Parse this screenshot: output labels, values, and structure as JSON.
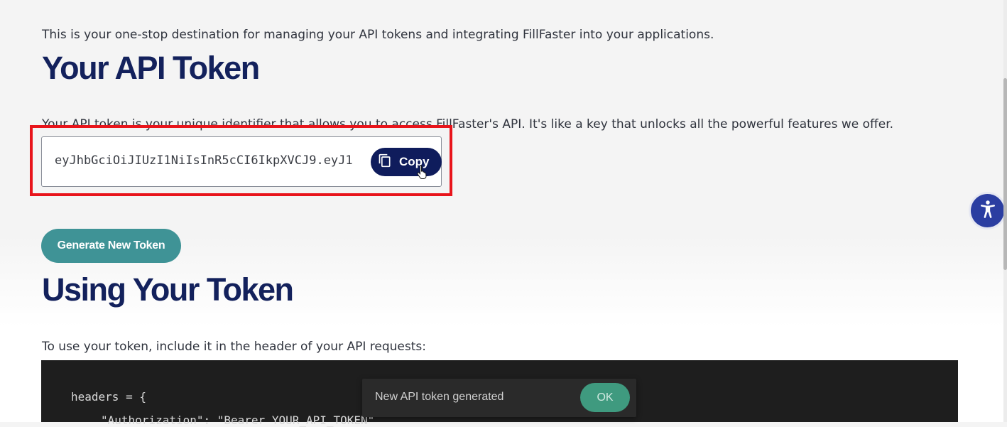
{
  "intro": {
    "text": "This is your one-stop destination for managing your API tokens and integrating FillFaster into your applications."
  },
  "token_section": {
    "title": "Your API Token",
    "description": "Your API token is your unique identifier that allows you to access FillFaster's API. It's like a key that unlocks all the powerful features we offer.",
    "token_value": "eyJhbGciOiJIUzI1NiIsInR5cCI6IkpXVCJ9.eyJ1",
    "copy_label": "Copy",
    "generate_label": "Generate New Token"
  },
  "usage_section": {
    "title": "Using Your Token",
    "description": "To use your token, include it in the header of your API requests:",
    "code_lines": [
      "headers = {",
      "\"Authorization\": \"Bearer YOUR_API_TOKEN\""
    ]
  },
  "toast": {
    "message": "New API token generated",
    "ok_label": "OK"
  },
  "icons": {
    "copy": "copy-icon",
    "cursor": "hand-pointer-icon",
    "accessibility": "accessibility-icon"
  },
  "colors": {
    "heading": "#13215c",
    "copy_button": "#0f1c5c",
    "generate_button": "#3f9396",
    "highlight_border": "#e8141b",
    "toast_ok": "#3f9a7f",
    "accessibility_button": "#2b3ea1",
    "code_background": "#1e1e1e"
  }
}
